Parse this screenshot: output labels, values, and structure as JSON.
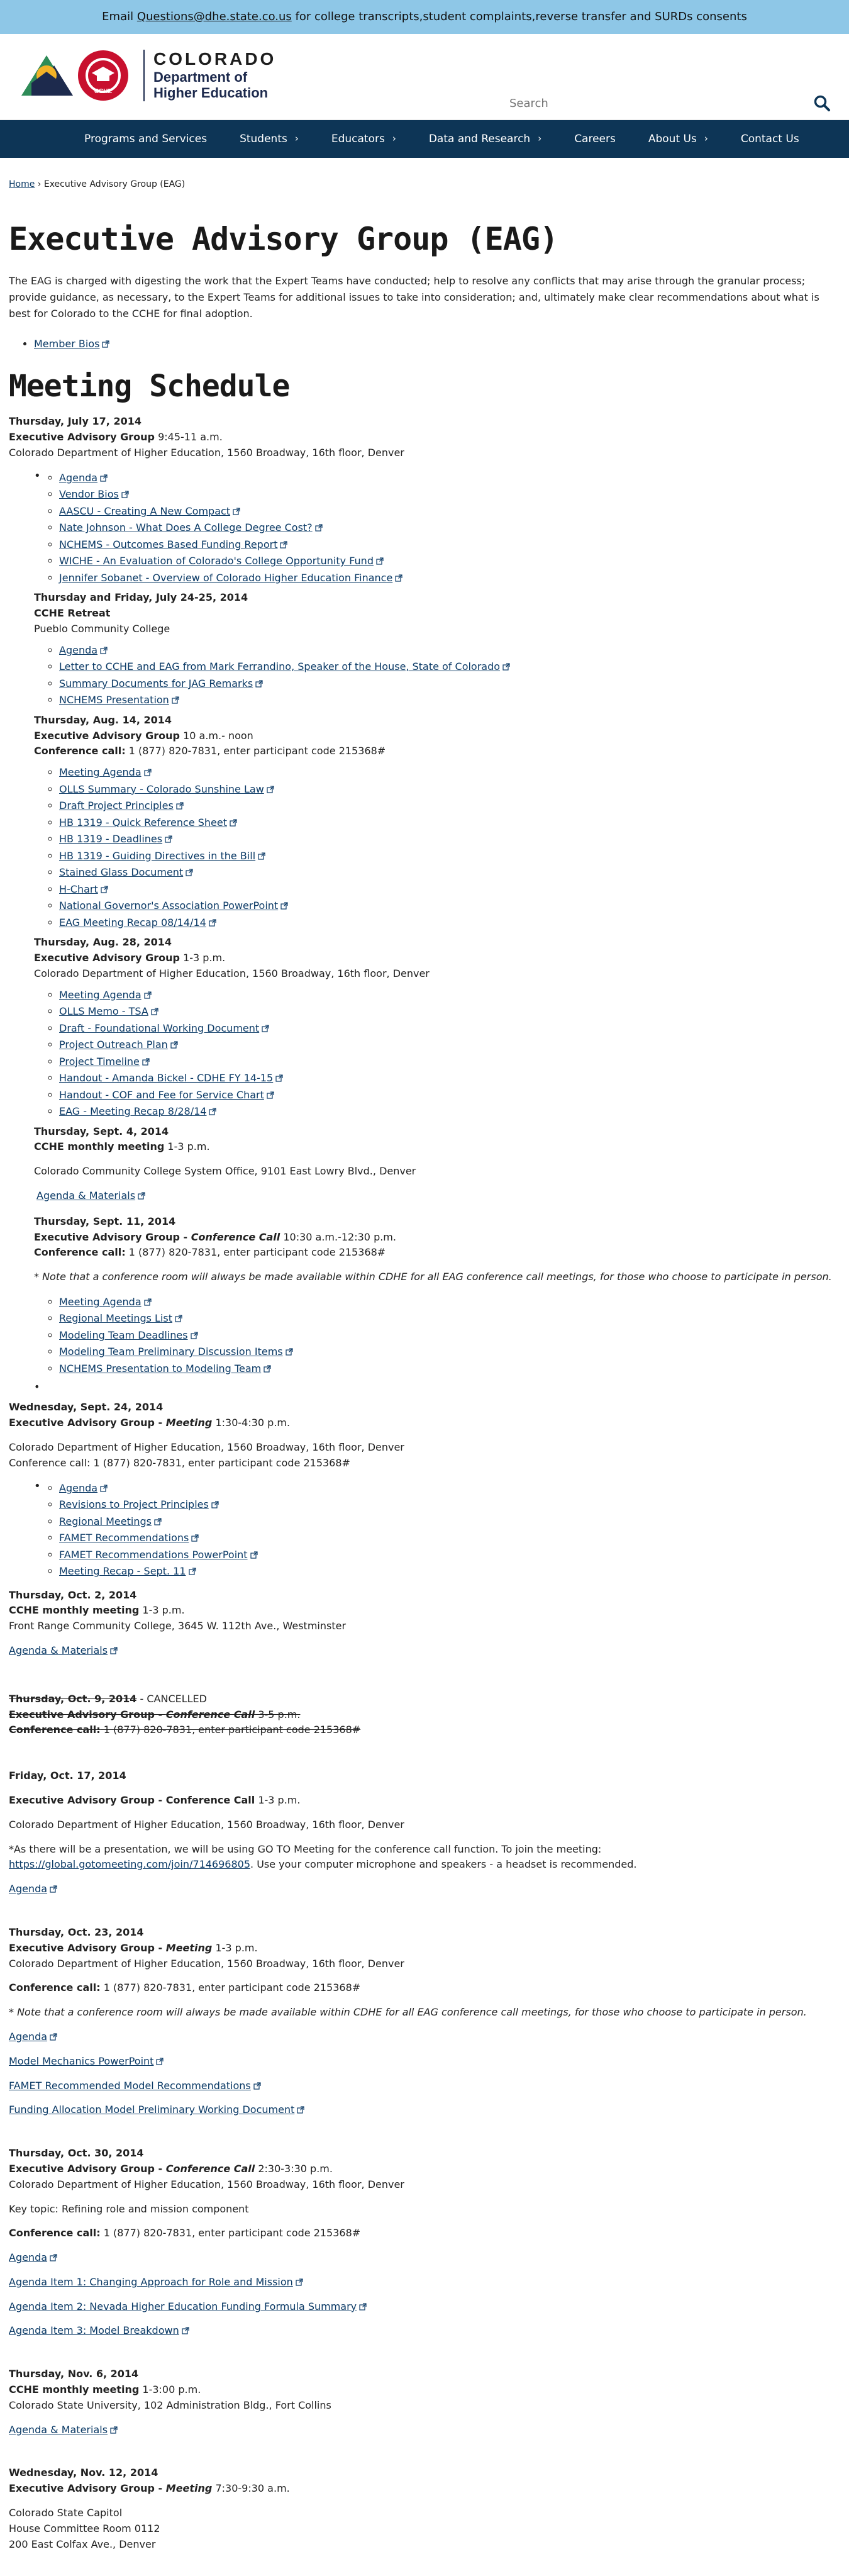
{
  "banner": {
    "prefix": "Email",
    "email": "Questions@dhe.state.co.us",
    "suffix": "for college transcripts,student complaints,reverse transfer and SURDs consents"
  },
  "header": {
    "logo_state": "COLORADO",
    "logo_dept_line1": "Department of",
    "logo_dept_line2": "Higher Education",
    "cche_badge": "CCHE",
    "search_placeholder": "Search"
  },
  "nav": [
    {
      "label": "Programs and Services",
      "has_menu": false
    },
    {
      "label": "Students",
      "has_menu": true
    },
    {
      "label": "Educators",
      "has_menu": true
    },
    {
      "label": "Data and Research",
      "has_menu": true
    },
    {
      "label": "Careers",
      "has_menu": false
    },
    {
      "label": "About Us",
      "has_menu": true
    },
    {
      "label": "Contact Us",
      "has_menu": false
    }
  ],
  "breadcrumb": {
    "home": "Home",
    "sep": "›",
    "current": "Executive Advisory Group (EAG)"
  },
  "page": {
    "title": "Executive Advisory Group (EAG)",
    "intro": "The EAG is charged with digesting the work that the Expert Teams have conducted; help to resolve any conflicts that may arise through the granular process; provide guidance, as necessary, to the Expert Teams for additional issues to take into consideration; and, ultimately make clear recommendations about what is best for Colorado to the CCHE for final adoption.",
    "member_bios": "Member Bios",
    "schedule_heading": "Meeting Schedule"
  },
  "meetings": {
    "m1": {
      "date": "Thursday, July 17, 2014",
      "title": "Executive Advisory Group",
      "time": " 9:45-11 a.m.",
      "location": "Colorado Department of Higher Education, 1560 Broadway, 16th floor, Denver",
      "links": [
        "Agenda",
        "Vendor Bios",
        "AASCU - Creating A New Compact",
        "Nate Johnson - What Does A College Degree Cost?",
        "NCHEMS - Outcomes Based Funding Report",
        "WICHE - An Evaluation of Colorado's College Opportunity Fund",
        "Jennifer Sobanet - Overview of Colorado Higher Education Finance"
      ]
    },
    "m2": {
      "date": "Thursday and Friday, July 24-25, 2014",
      "title": "CCHE Retreat",
      "location": "Pueblo Community College",
      "links": [
        "Agenda",
        "Letter to CCHE and EAG from Mark Ferrandino, Speaker of the House, State of Colorado",
        "Summary Documents for JAG Remarks",
        "NCHEMS Presentation"
      ]
    },
    "m3": {
      "date": "Thursday, Aug. 14, 2014",
      "title": "Executive Advisory Group",
      "time": " 10 a.m.- noon",
      "call_label": "Conference call:",
      "call_value": "  1 (877) 820-7831, enter participant code 215368#",
      "links": [
        "Meeting Agenda",
        "OLLS Summary - Colorado Sunshine Law",
        "Draft Project Principles",
        "HB 1319 - Quick Reference Sheet",
        "HB 1319 - Deadlines",
        "HB 1319 - Guiding Directives in the Bill",
        "Stained Glass Document",
        "H-Chart",
        "National Governor's Association PowerPoint",
        "EAG Meeting Recap 08/14/14"
      ]
    },
    "m4": {
      "date": "Thursday, Aug. 28, 2014",
      "title": "Executive Advisory Group",
      "time": " 1-3 p.m.",
      "location": "Colorado Department of Higher Education, 1560 Broadway, 16th floor, Denver",
      "links": [
        "Meeting Agenda",
        "OLLS Memo - TSA",
        "Draft - Foundational Working Document",
        "Project Outreach Plan",
        "Project Timeline",
        "Handout - Amanda Bickel - CDHE FY 14-15",
        "Handout - COF and Fee for Service Chart",
        "EAG - Meeting Recap 8/28/14"
      ]
    },
    "m5": {
      "date": "Thursday, Sept. 4, 2014",
      "title": "CCHE monthly meeting",
      "time": " 1-3 p.m.",
      "location": "Colorado Community College System Office, 9101 East Lowry Blvd., Denver",
      "link": "Agenda & Materials"
    },
    "m6": {
      "date": "Thursday, Sept. 11, 2014",
      "title": "Executive Advisory Group - ",
      "title_em": "Conference Call",
      "time": " 10:30 a.m.-12:30 p.m.",
      "call_label": "Conference call:",
      "call_value": " 1 (877) 820-7831, enter participant code 215368#",
      "note": "* Note that a conference room will always be made available within CDHE for all EAG conference call meetings, for those who choose to participate in person.",
      "links": [
        "Meeting Agenda",
        "Regional Meetings List",
        "Modeling Team Deadlines",
        "Modeling Team Preliminary Discussion Items",
        "NCHEMS Presentation to Modeling Team"
      ]
    },
    "m7": {
      "date": "Wednesday, Sept. 24, 2014",
      "title": "Executive Advisory Group - ",
      "title_em": "Meeting",
      "time": " 1:30-4:30 p.m.",
      "location": "Colorado Department of Higher Education, 1560 Broadway, 16th floor, Denver",
      "call": "Conference call: 1 (877) 820-7831, enter participant code 215368#",
      "links": [
        "Agenda",
        "Revisions to Project Principles",
        "Regional Meetings",
        "FAMET Recommendations",
        "FAMET Recommendations PowerPoint",
        "Meeting Recap - Sept. 11"
      ]
    },
    "m8": {
      "date": "Thursday, Oct. 2, 2014",
      "title": "CCHE monthly meeting",
      "time": " 1-3 p.m.",
      "location": "Front Range Community College, 3645 W. 112th Ave., Westminster",
      "link": "Agenda & Materials"
    },
    "m9": {
      "date": "Thursday, Oct. 9, 2014",
      "cancelled": " - CANCELLED",
      "title": "Executive Advisory Group - ",
      "title_em": "Conference Call",
      "time": " 3-5 p.m.",
      "call_label": "Conference call:",
      "call_value": " 1 (877) 820-7831, enter participant code 215368#"
    },
    "m10": {
      "date": "Friday, Oct. 17, 2014",
      "title": "Executive Advisory Group - Conference Call",
      "time": " 1-3 p.m.",
      "location": "Colorado Department of Higher Education, 1560 Broadway, 16th floor, Denver",
      "note_pre": "*As there will be a presentation, we will be using GO TO Meeting for the conference call function. To join the meeting:",
      "note_link": "https://global.gotomeeting.com/join/714696805",
      "note_post": ". Use your computer microphone and speakers - a headset is recommended.",
      "link": "Agenda"
    },
    "m11": {
      "date": "Thursday, Oct. 23, 2014",
      "title": "Executive Advisory Group - ",
      "title_em": "Meeting",
      "time": " 1-3 p.m.",
      "location": "Colorado Department of Higher Education, 1560 Broadway, 16th floor, Denver",
      "call_label": "Conference call:",
      "call_value": " 1 (877) 820-7831, enter participant code 215368#",
      "note": "* Note that a conference room will always be made available within CDHE for all EAG conference call meetings, for those who choose to participate in person.",
      "links": [
        "Agenda",
        "Model Mechanics PowerPoint",
        "FAMET Recommended Model Recommendations",
        "Funding Allocation Model Preliminary Working Document"
      ]
    },
    "m12": {
      "date": "Thursday, Oct. 30, 2014",
      "title": "Executive Advisory Group - ",
      "title_em": "Conference Call",
      "time": " 2:30-3:30 p.m.",
      "location": "Colorado Department of Higher Education, 1560 Broadway, 16th floor, Denver",
      "topic": "Key topic: Refining role and mission component",
      "call_label": "Conference call:",
      "call_value": " 1 (877) 820-7831, enter participant code 215368#",
      "links": [
        "Agenda",
        "Agenda Item 1: Changing Approach for Role and Mission",
        "Agenda Item 2: Nevada Higher Education Funding Formula Summary",
        "Agenda Item 3: Model Breakdown"
      ]
    },
    "m13": {
      "date": "Thursday, Nov. 6, 2014",
      "title": "CCHE monthly meeting",
      "time": " 1-3:00 p.m.",
      "location": "Colorado State University, 102 Administration Bldg., Fort Collins",
      "link": "Agenda & Materials"
    },
    "m14": {
      "date": "Wednesday, Nov. 12, 2014",
      "title": "Executive Advisory Group - ",
      "title_em": "Meeting",
      "time": " 7:30-9:30 a.m.",
      "loc1": "Colorado State Capitol",
      "loc2": "House Committee Room 0112",
      "loc3": "200 East Colfax Ave., Denver"
    }
  },
  "colors": {
    "banner_bg": "#8ec7e7",
    "nav_bg": "#0d3556",
    "link": "#0b3a66",
    "logo_red": "#c8102e",
    "logo_navy": "#1d2a4d",
    "logo_gold": "#f2b227",
    "logo_green": "#2e8b57"
  },
  "icons": {
    "external": "external-link-icon",
    "search": "search-icon",
    "chevron": "chevron-right-icon"
  }
}
